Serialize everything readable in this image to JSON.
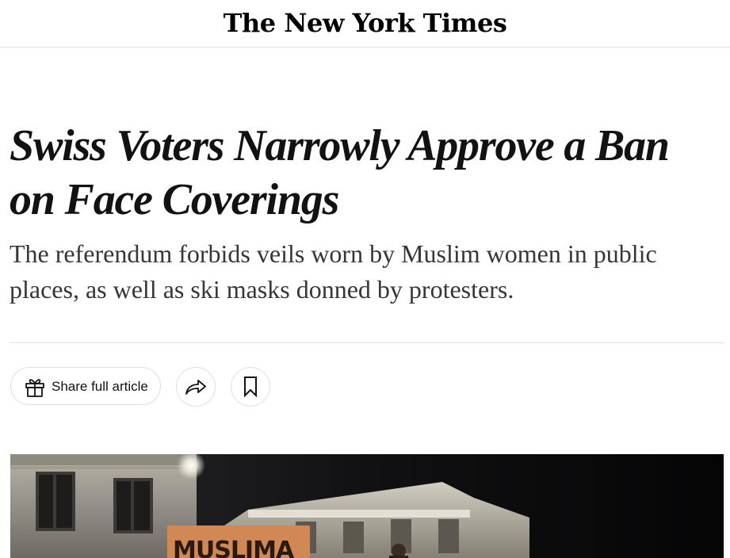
{
  "masthead": {
    "logo_text": "The New York Times"
  },
  "article": {
    "headline": "Swiss Voters Narrowly Approve a Ban on Face Coverings",
    "summary": "The referendum forbids veils worn by Muslim women in public places, as well as ski masks donned by protesters."
  },
  "actions": {
    "share_full_article_label": "Share full article",
    "share_icon": "share-arrow-icon",
    "bookmark_icon": "bookmark-icon",
    "gift_icon": "gift-icon"
  },
  "photo": {
    "sign_text": "MUSLIMA"
  },
  "colors": {
    "text": "#121212",
    "summary": "#363636",
    "border": "#e2e2e2"
  }
}
